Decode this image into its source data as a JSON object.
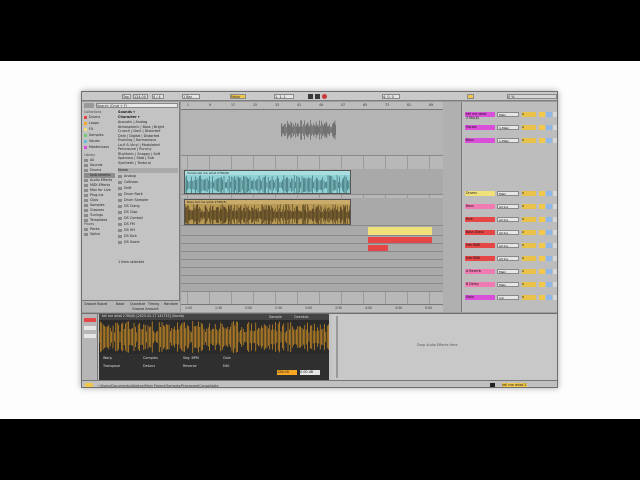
{
  "colors": {
    "accent_yellow": "#f2c84b",
    "wave_orange": "#f6a623",
    "clip_cyan": "#8fd1d5",
    "clip_olive": "#b99a55",
    "track_red": "#e54646",
    "track_magenta": "#d94fd9",
    "track_yellow": "#efe07a",
    "track_pink": "#f07bb2"
  },
  "transport": {
    "tap": "Tap",
    "tempo": "124.00",
    "signature": "4 / 4",
    "quantize": "1 Bar",
    "key": "Major",
    "position": "1. 1. 1",
    "loop_length": "4. 0. 0",
    "cpu": "0 %"
  },
  "browser": {
    "search_placeholder": "Search (Cmd + F)",
    "collections_label": "Collections",
    "collections": [
      {
        "label": "Drums",
        "color": "#e54646"
      },
      {
        "label": "Loops",
        "color": "#f6a623"
      },
      {
        "label": "FX",
        "color": "#efe07a"
      },
      {
        "label": "Samples",
        "color": "#6fcf6f"
      },
      {
        "label": "Vocals",
        "color": "#5bc0de"
      },
      {
        "label": "Masterclass",
        "color": "#d94fd9"
      }
    ],
    "library_label": "Library",
    "library": [
      {
        "label": "All",
        "selected": false
      },
      {
        "label": "Sounds",
        "selected": false
      },
      {
        "label": "Drums",
        "selected": false
      },
      {
        "label": "Instruments",
        "selected": true
      },
      {
        "label": "Audio Effects",
        "selected": false
      },
      {
        "label": "MIDI Effects",
        "selected": false
      },
      {
        "label": "Max for Live",
        "selected": false
      },
      {
        "label": "Plug-Ins",
        "selected": false
      },
      {
        "label": "Clips",
        "selected": false
      },
      {
        "label": "Samples",
        "selected": false
      },
      {
        "label": "Grooves",
        "selected": false
      },
      {
        "label": "Tunings",
        "selected": false
      },
      {
        "label": "Templates",
        "selected": false
      }
    ],
    "places_label": "Places",
    "places": [
      "Packs",
      "Splice"
    ],
    "tags_top": [
      "Sounds ▾",
      "Character ▾"
    ],
    "tags": [
      "Acoustic | Analog",
      "Atmospheric | Bass | Bright",
      "Crunch | Dark | Distorted",
      "Dark | Digital | Distorted",
      "Evolving | Harmonious",
      "Lo-fi & Vinyl | Modulated",
      "Percussive | Punchy",
      "Rhythmic | Snappy | Soft",
      "Spacious | Stab | Sub",
      "Synthetic | Textural"
    ],
    "list_header": "Name",
    "list_items": [
      "Analog",
      "Collision",
      "Drift",
      "Drum Rack",
      "Drum Sampler",
      "DS Clang",
      "DS Clap",
      "DS Cymbal",
      "DS FM",
      "DS HH",
      "DS Kick",
      "DS Snare"
    ],
    "footer_left": "Groove Board",
    "footer_items": [
      "Base",
      "Quantize",
      "Timing",
      "Random"
    ],
    "footer_amount": "Groove Amount",
    "item_count": "1 Item selected"
  },
  "arrangement": {
    "ruler": [
      "1",
      "9",
      "17",
      "25",
      "33",
      "41",
      "49",
      "57",
      "65",
      "73",
      "81",
      "89"
    ],
    "time_ruler": [
      "1:00",
      "1:30",
      "2:00",
      "2:30",
      "3:00",
      "3:30",
      "4:00",
      "4:30",
      "5:00"
    ],
    "clip1": "Vocals tell me what 2780(8)",
    "clip2": "Bass tell me what 2780(8)"
  },
  "mixer": {
    "tracks": [
      {
        "name": "tell me what 2780(8)",
        "field": "Main",
        "vol": "0",
        "color": "#d94fd9"
      },
      {
        "name": "Vocals",
        "field": "1-Main",
        "vol": "0",
        "color": "#d94fd9"
      },
      {
        "name": "Bass",
        "field": "1-Main",
        "vol": "0",
        "color": "#d94fd9"
      },
      {
        "name": "Drums",
        "field": "Main",
        "vol": "0",
        "color": "#efe07a"
      },
      {
        "name": "Bass",
        "field": "All Ins",
        "vol": "0",
        "color": "#f07bb2"
      },
      {
        "name": "Kick",
        "field": "All Ins",
        "vol": "0",
        "color": "#e54646"
      },
      {
        "name": "Bass Glass",
        "field": "All Ins",
        "vol": "0",
        "color": "#e54646"
      },
      {
        "name": "Hat MIDI",
        "field": "All Ins",
        "vol": "0",
        "color": "#e54646"
      },
      {
        "name": "Hat MIDI",
        "field": "All Ins",
        "vol": "0",
        "color": "#e54646"
      },
      {
        "name": "A Reverb",
        "field": "Main",
        "vol": "0",
        "color": "#f07bb2"
      },
      {
        "name": "B Delay",
        "field": "Main",
        "vol": "0",
        "color": "#f07bb2"
      },
      {
        "name": "Main",
        "field": "1/2",
        "vol": "0",
        "color": "#d94fd9"
      }
    ]
  },
  "detail": {
    "sample_header": "tell me what 2780(8) [2025-02-17 141753] (Vocals)",
    "sample_tab": "Sample",
    "overdub": "Overdub",
    "controls": [
      "Warp",
      "Complex",
      "Seg. BPM",
      "Gain",
      "Transpose",
      "Detune",
      "Reverse",
      "Edit"
    ],
    "bpm": "128.00",
    "gain": "0.00 dB",
    "drop_text": "Drop Audio Effects Here",
    "status_path": "tell me what 2780(8) [2025-02-17 141753] (Vocals)",
    "status_location": "~/Users/Documents/Ableton/Main Project/Samples/Processed/Consolidate"
  }
}
